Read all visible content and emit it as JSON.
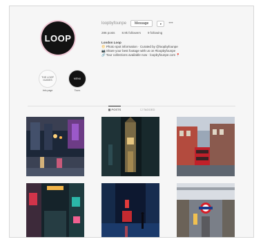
{
  "profile": {
    "avatar_text": "LOOP",
    "username": "loopbyfounpe",
    "message_label": "Message",
    "follow_label": "▾",
    "more_label": "•••",
    "stats": {
      "posts": "286 posts",
      "followers": "8.9k followers",
      "following": "9 following"
    },
    "bio": {
      "name": "London Loop",
      "line1": "🌕 Photo spot information · Curated by @loopbyfounpe",
      "line2": "📷 Share your best footage with us on #loopbyfounpe",
      "line3": "🔗 Tour collections available now · loopbyfounpe.com 📍",
      "link": "loopbyfounpe.com"
    }
  },
  "highlights": [
    {
      "ring_text": "THE LOOP GUIDES",
      "label": "Info page"
    },
    {
      "ring_text": "MENU",
      "label": "Tours"
    }
  ],
  "tabs": [
    {
      "label": "▦ POSTS",
      "active": true
    },
    {
      "label": "☐ TAGGED",
      "active": false
    }
  ]
}
